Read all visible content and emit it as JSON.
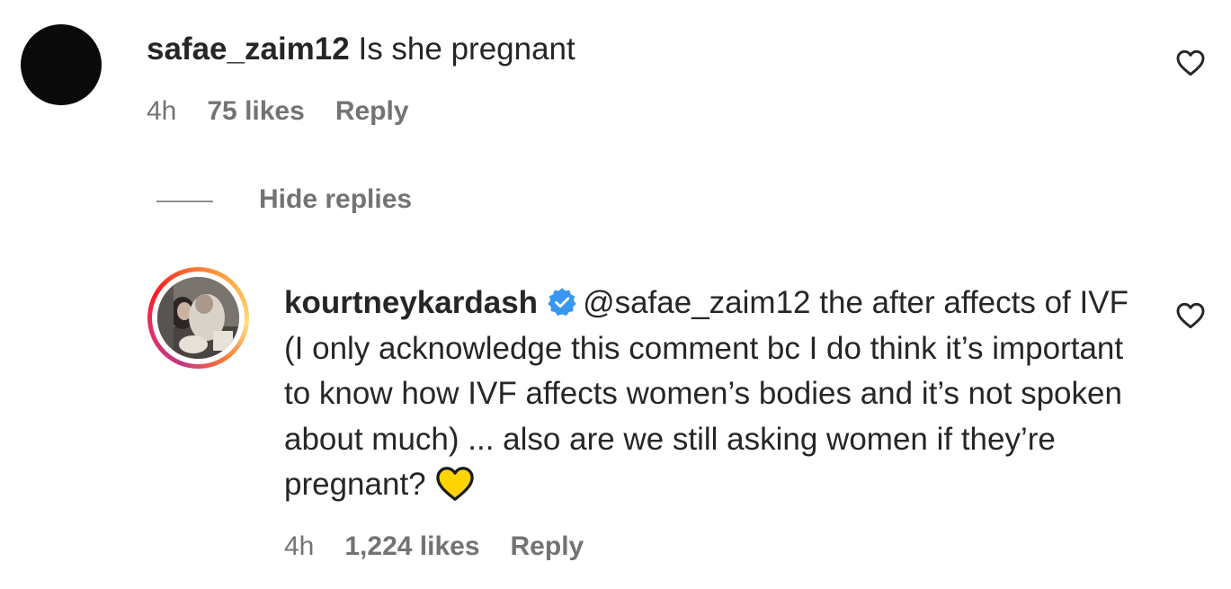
{
  "comment1": {
    "username": "safae_zaim12",
    "text": "Is she pregnant",
    "time": "4h",
    "likes": "75 likes",
    "reply_label": "Reply",
    "avatar_color": "#0a0a0a"
  },
  "replies_toggle": {
    "label": "Hide replies"
  },
  "comment2": {
    "username": "kourtneykardash",
    "verified_icon": "verified-badge-icon",
    "mention": "@safae_zaim12",
    "text": "the after affects of IVF (I only acknowledge this comment bc I do think it’s important to know how IVF affects women’s bodies and it’s not spoken about much) ... also are we still asking women if they’re pregnant?",
    "emoji": "yellow-heart-icon",
    "time": "4h",
    "likes": "1,224 likes",
    "reply_label": "Reply"
  },
  "colors": {
    "text": "#262626",
    "meta": "#737373",
    "verified": "#3897f0",
    "emoji_heart": "#ffd400"
  }
}
